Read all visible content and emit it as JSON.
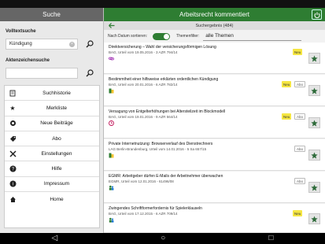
{
  "left": {
    "header": "Suche",
    "fulltext_label": "Volltextsuche",
    "fulltext_value": "Kündigung",
    "file_label": "Aktenzeichensuche",
    "file_value": "",
    "menu": [
      {
        "label": "Suchhistorie",
        "icon": "history-icon"
      },
      {
        "label": "Merkliste",
        "icon": "star-icon"
      },
      {
        "label": "Neue Beiträge",
        "icon": "new-items-icon"
      },
      {
        "label": "Abo",
        "icon": "tag-icon"
      },
      {
        "label": "Einstellungen",
        "icon": "tools-icon"
      },
      {
        "label": "Hilfe",
        "icon": "help-icon"
      },
      {
        "label": "Impressum",
        "icon": "info-icon"
      },
      {
        "label": "Home",
        "icon": "home-icon"
      }
    ]
  },
  "right": {
    "header": "Arbeitsrecht kommentiert",
    "results": "Suchergebnis (484)",
    "sort_label": "Nach Datum sortieren:",
    "filter_label": "Themenfilter:",
    "filter_value": "alle Themen",
    "items": [
      {
        "title": "Direktversicherung – Wahl der versicherungsförmigen Lösung",
        "meta": "BAG, Urteil vom 19.05.2016 - 3 AZR 794/14",
        "icon": "link-icon",
        "badges": [
          "Neu"
        ],
        "star": "star-icon"
      },
      {
        "title": "Bestimmtheit einer hilfsweise erklärten ordentlichen Kündigung",
        "meta": "BAG, Urteil vom 20.01.2016 - 6 AZR 782/14",
        "icon": "paragraph-icon",
        "badges": [
          "Neu",
          "Abo"
        ],
        "star": "star-icon"
      },
      {
        "title": "Versagung von Entgelterhöhungen bei Altersteilzeit im Blockmodell",
        "meta": "BAG, Urteil vom 19.01.2016 - 9 AZR 564/14",
        "icon": "clock-icon",
        "badges": [
          "Neu",
          "Abo"
        ],
        "star": "star-icon"
      },
      {
        "title": "Private Internetnutzung: Browserverlauf des Dienstrechners",
        "meta": "LAG Berlin-Brandenburg, Urteil vom 14.01.2016 - 5 Sa 657/15",
        "icon": "paragraph-icon",
        "badges": [
          "Abo"
        ],
        "star": "star-icon"
      },
      {
        "title": "EGMR: Arbeitgeber dürfen E-Mails der Arbeitnehmer überwachen",
        "meta": "EGMR, Urteil vom 12.01.2016 - 61496/08",
        "icon": "people-icon",
        "badges": [
          "Abo"
        ],
        "star": "star-icon"
      },
      {
        "title": "Zwingendes Schriftformerfordernis für Spielerklauseln",
        "meta": "BAG, Urteil vom 17.12.2015 - 6 AZR 709/14",
        "icon": "people-icon",
        "badges": [
          "Neu"
        ],
        "star": "star-icon"
      }
    ]
  },
  "navbar": {
    "back": "back-icon",
    "home": "home-icon",
    "recents": "recents-icon"
  }
}
